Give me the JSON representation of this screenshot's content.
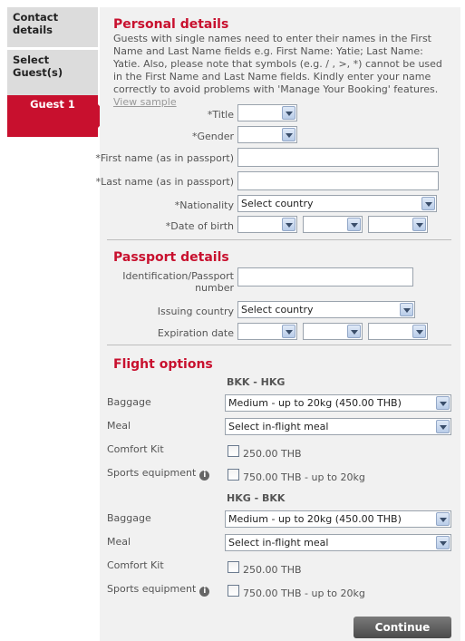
{
  "sidebar": {
    "tabs": [
      {
        "label": "Contact details"
      },
      {
        "label": "Select Guest(s)"
      },
      {
        "label": "Guest 1"
      }
    ]
  },
  "personal": {
    "title": "Personal details",
    "intro": "Guests with single names need to enter their names in the First Name and Last Name fields e.g. First Name: Yatie; Last Name: Yatie. Also, please note that symbols (e.g. / , >, *) cannot be used in the First Name and Last Name fields. Kindly enter your name correctly to avoid problems with 'Manage Your Booking' features.",
    "view_sample": "View sample",
    "labels": {
      "title": "*Title",
      "gender": "*Gender",
      "first_name": "*First name (as in passport)",
      "last_name": "*Last name (as in passport)",
      "nationality": "*Nationality",
      "dob": "*Date of birth"
    },
    "values": {
      "title": "",
      "gender": "",
      "first_name": "",
      "last_name": "",
      "nationality": "Select country",
      "dob_day": "",
      "dob_month": "",
      "dob_year": ""
    }
  },
  "passport": {
    "title": "Passport details",
    "labels": {
      "id": "Identification/Passport number",
      "issuing_country": "Issuing country",
      "expiration": "Expiration date"
    },
    "values": {
      "id": "",
      "issuing_country": "Select country",
      "exp_day": "",
      "exp_month": "",
      "exp_year": ""
    }
  },
  "flight": {
    "title": "Flight options",
    "segments": [
      {
        "route": "BKK - HKG",
        "baggage_label": "Baggage",
        "baggage_value": "Medium - up to 20kg (450.00 THB)",
        "meal_label": "Meal",
        "meal_value": "Select in-flight meal",
        "comfort_label": "Comfort Kit",
        "comfort_price": "250.00 THB",
        "sports_label": "Sports equipment",
        "sports_price": "750.00 THB - up to 20kg"
      },
      {
        "route": "HKG - BKK",
        "baggage_label": "Baggage",
        "baggage_value": "Medium - up to 20kg (450.00 THB)",
        "meal_label": "Meal",
        "meal_value": "Select in-flight meal",
        "comfort_label": "Comfort Kit",
        "comfort_price": "250.00 THB",
        "sports_label": "Sports equipment",
        "sports_price": "750.00 THB - up to 20kg"
      }
    ]
  },
  "continue_label": "Continue",
  "colors": {
    "accent": "#c8102e",
    "panel_bg": "#f1f1f1",
    "tab_bg": "#dcdcdc"
  },
  "icons": [
    "info-icon",
    "dropdown-arrow-icon"
  ]
}
